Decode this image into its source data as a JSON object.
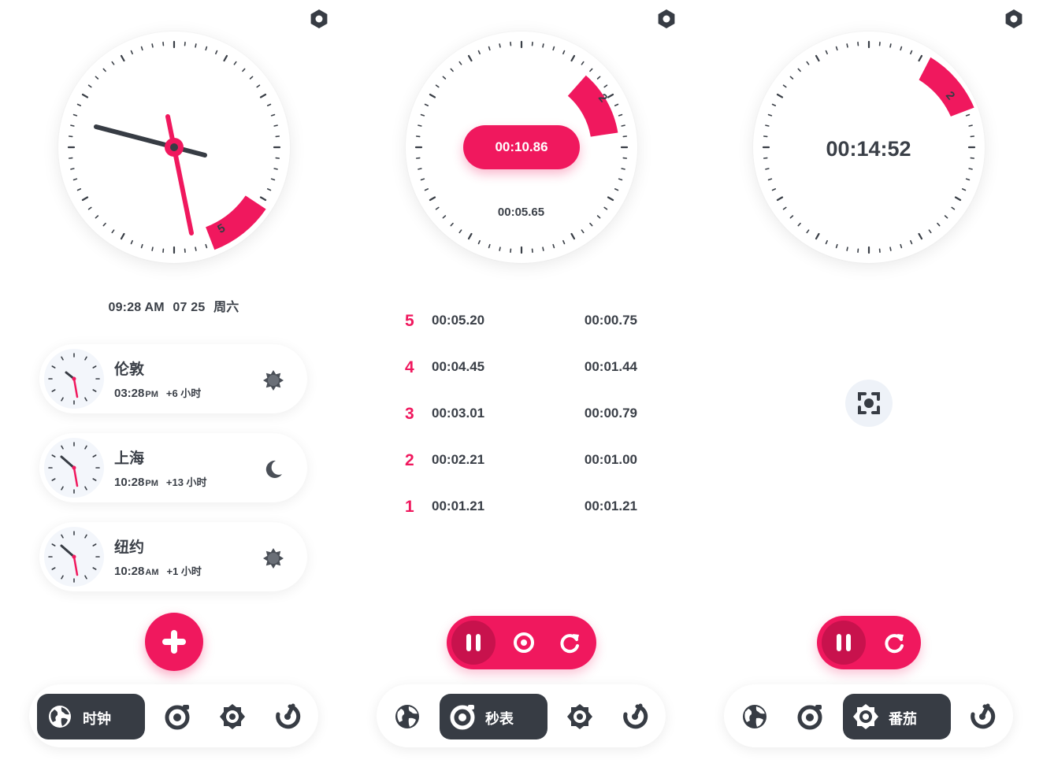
{
  "colors": {
    "accent": "#f0185e",
    "accent_dark": "#c8124d",
    "dark": "#373c44",
    "card": "#ffffff",
    "mini_face": "#f3f6fb"
  },
  "clock_panel": {
    "dial_badge": "5",
    "date_line": {
      "time": "09:28 AM",
      "date": "07 25",
      "weekday": "周六"
    },
    "cities": [
      {
        "name": "伦敦",
        "time": "03:28",
        "ampm": "PM",
        "offset": "+6 小时",
        "weather_icon": "sun-icon"
      },
      {
        "name": "上海",
        "time": "10:28",
        "ampm": "PM",
        "offset": "+13 小时",
        "weather_icon": "moon-icon"
      },
      {
        "name": "纽约",
        "time": "10:28",
        "ampm": "AM",
        "offset": "+1 小时",
        "weather_icon": "sun-icon"
      }
    ],
    "add_button_icon": "plus-icon",
    "nav": {
      "active_label": "时钟",
      "active_icon": "globe-icon"
    }
  },
  "stopwatch_panel": {
    "dial_badge": "2",
    "main_time": "00:10.86",
    "sub_time": "00:05.65",
    "laps": [
      {
        "num": "5",
        "total": "00:05.20",
        "split": "00:00.75"
      },
      {
        "num": "4",
        "total": "00:04.45",
        "split": "00:01.44"
      },
      {
        "num": "3",
        "total": "00:03.01",
        "split": "00:00.79"
      },
      {
        "num": "2",
        "total": "00:02.21",
        "split": "00:01.00"
      },
      {
        "num": "1",
        "total": "00:01.21",
        "split": "00:01.21"
      }
    ],
    "nav": {
      "active_label": "秒表",
      "active_icon": "stopwatch-icon"
    }
  },
  "pomodoro_panel": {
    "dial_badge": "2",
    "main_time": "00:14:52",
    "nav": {
      "active_label": "番茄",
      "active_icon": "timer-icon"
    }
  }
}
